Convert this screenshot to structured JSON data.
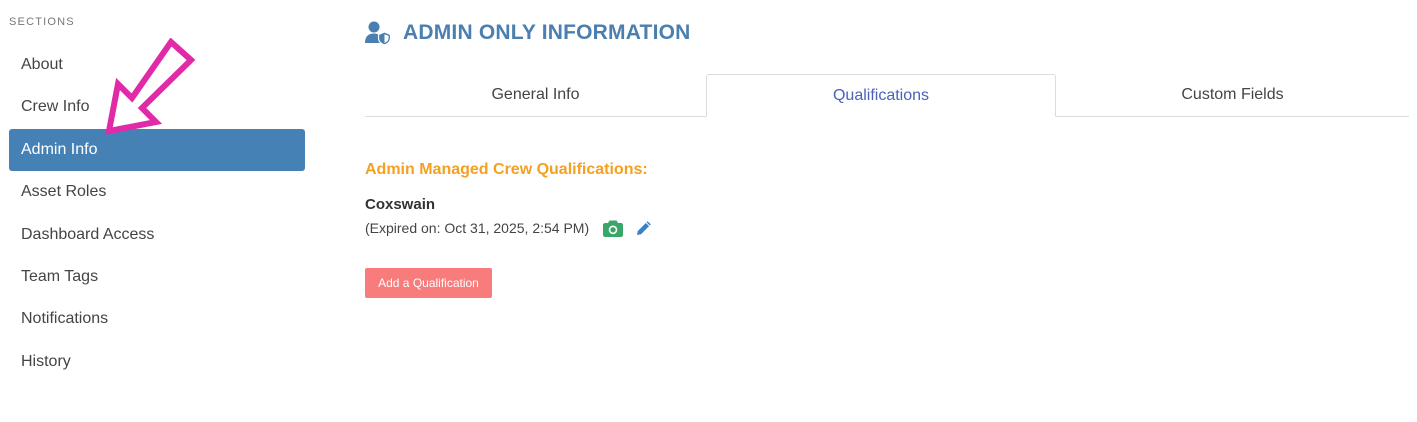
{
  "sidebar": {
    "heading": "SECTIONS",
    "items": [
      {
        "label": "About"
      },
      {
        "label": "Crew Info"
      },
      {
        "label": "Admin Info",
        "active": true
      },
      {
        "label": "Asset Roles"
      },
      {
        "label": "Dashboard Access"
      },
      {
        "label": "Team Tags"
      },
      {
        "label": "Notifications"
      },
      {
        "label": "History"
      }
    ]
  },
  "main": {
    "title": "ADMIN ONLY INFORMATION",
    "title_icon": "user-shield-icon",
    "tabs": [
      {
        "label": "General Info"
      },
      {
        "label": "Qualifications",
        "active": true
      },
      {
        "label": "Custom Fields"
      }
    ],
    "section_heading": "Admin Managed Crew Qualifications:",
    "qualifications": [
      {
        "name": "Coxswain",
        "expiry": "(Expired on: Oct 31, 2025, 2:54 PM)",
        "icons": [
          "camera-icon",
          "pencil-icon"
        ]
      }
    ],
    "add_button_label": "Add a Qualification"
  },
  "colors": {
    "active_sidebar_bg": "#4681b5",
    "title_color": "#4a7fb0",
    "active_tab_text": "#4a62b8",
    "section_heading_color": "#f4a020",
    "camera_icon_color": "#3aa66a",
    "pencil_icon_color": "#3b7fc4",
    "add_button_bg": "#f87c7c",
    "annotation_arrow_color": "#e02aa8"
  }
}
